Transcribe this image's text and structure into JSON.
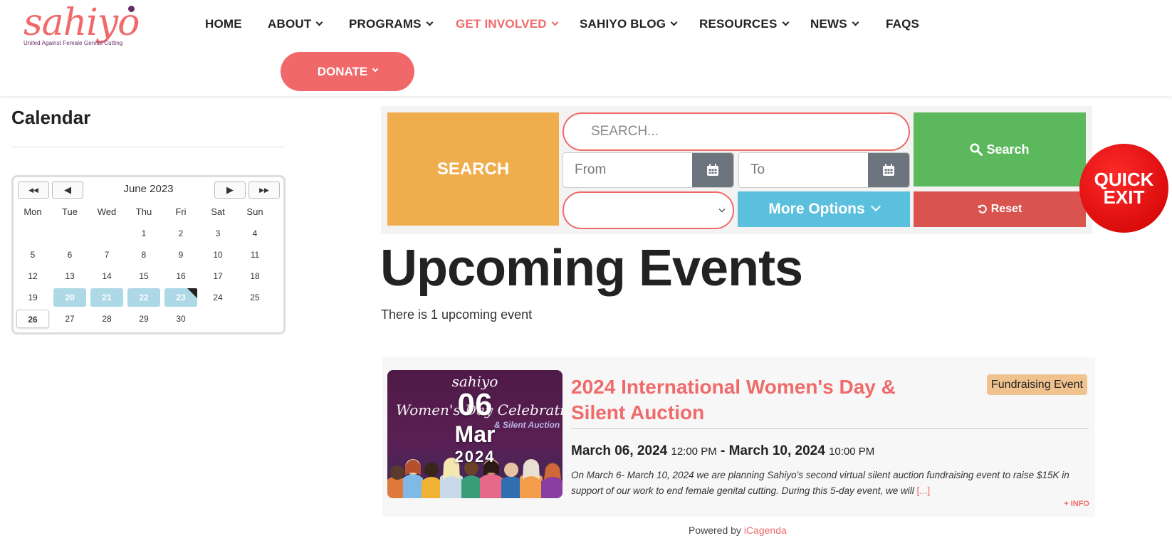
{
  "logo": {
    "word": "sahiyo",
    "tagline": "United Against Female Genital Cutting"
  },
  "nav": {
    "items": [
      {
        "label": "HOME",
        "dropdown": false
      },
      {
        "label": "ABOUT",
        "dropdown": true
      },
      {
        "label": "PROGRAMS",
        "dropdown": true
      },
      {
        "label": "GET INVOLVED",
        "dropdown": true,
        "active": true
      },
      {
        "label": "SAHIYO BLOG",
        "dropdown": true
      },
      {
        "label": "RESOURCES",
        "dropdown": true
      },
      {
        "label": "NEWS",
        "dropdown": true
      },
      {
        "label": "FAQS",
        "dropdown": false
      }
    ],
    "donate_label": "DONATE"
  },
  "sidebar": {
    "title": "Calendar"
  },
  "calendar": {
    "month_label": "June 2023",
    "nav_buttons": {
      "prev_year": "◀◀",
      "prev_month": "◀",
      "next_month": "▶",
      "next_year": "▶▶"
    },
    "weekdays": [
      "Mon",
      "Tue",
      "Wed",
      "Thu",
      "Fri",
      "Sat",
      "Sun"
    ],
    "weeks": [
      [
        "",
        "",
        "",
        "1",
        "2",
        "3",
        "4"
      ],
      [
        "5",
        "6",
        "7",
        "8",
        "9",
        "10",
        "11"
      ],
      [
        "12",
        "13",
        "14",
        "15",
        "16",
        "17",
        "18"
      ],
      [
        "19",
        "20",
        "21",
        "22",
        "23",
        "24",
        "25"
      ],
      [
        "26",
        "27",
        "28",
        "29",
        "30",
        "",
        ""
      ]
    ],
    "event_days": [
      "20",
      "21",
      "22",
      "23"
    ],
    "today": "26",
    "event_color": "#add8e6"
  },
  "search": {
    "label": "SEARCH",
    "placeholder": "SEARCH...",
    "from_placeholder": "From",
    "to_placeholder": "To",
    "category_selected": "",
    "more_options_label": "More Options",
    "search_button": "Search",
    "reset_button": "Reset"
  },
  "quick_exit": {
    "line1": "QUICK",
    "line2": "EXIT"
  },
  "main": {
    "title": "Upcoming Events",
    "count_text": "There is 1 upcoming event"
  },
  "event": {
    "image": {
      "brand": "sahiyo",
      "script": "Women's Day Celebration",
      "sub": "& Silent Auction"
    },
    "day": "06",
    "month": "Mar",
    "year": "2024",
    "title": "2024 International Women's Day & Silent Auction",
    "category": "Fundraising Event",
    "category_color": "#f0c38e",
    "start_date": "March 06, 2024",
    "start_time": "12:00 PM",
    "separator": "-",
    "end_date": "March 10, 2024",
    "end_time": "10:00 PM",
    "description": "On March 6- March 10, 2024 we are planning Sahiyo's second virtual silent auction fundraising event to raise $15K in support of our work to end female genital cutting. During this 5-day event, we will",
    "read_more": "[...]",
    "info_link": "+ INFO"
  },
  "footer": {
    "powered_prefix": "Powered by",
    "powered_brand": "iCagenda"
  },
  "colors": {
    "accent": "#f06a6a",
    "search_orange": "#f0ad4e",
    "search_green": "#5cb85c",
    "reset_red": "#d9534f",
    "more_blue": "#5bc0de"
  }
}
